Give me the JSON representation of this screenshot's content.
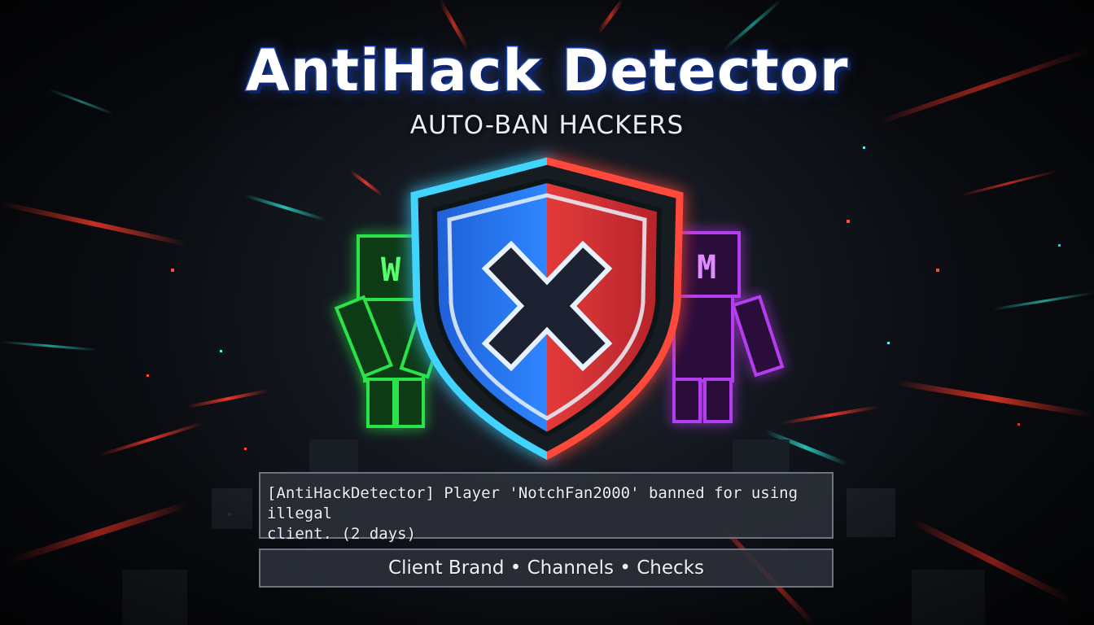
{
  "header": {
    "title": "AntiHack Detector",
    "subtitle": "AUTO-BAN HACKERS"
  },
  "emblem": {
    "shield_icon": "shield-x-icon",
    "left_color": "#2f86ff",
    "right_color": "#ff3b3b"
  },
  "characters": {
    "left": {
      "letter": "W",
      "color": "#29e34a"
    },
    "right": {
      "letter": "M",
      "color": "#b43cf0"
    }
  },
  "chat": {
    "message": "[AntiHackDetector] Player 'NotchFan2000' banned for using illegal\nclient. (2 days)"
  },
  "features": {
    "text": "Client Brand • Channels • Checks"
  }
}
